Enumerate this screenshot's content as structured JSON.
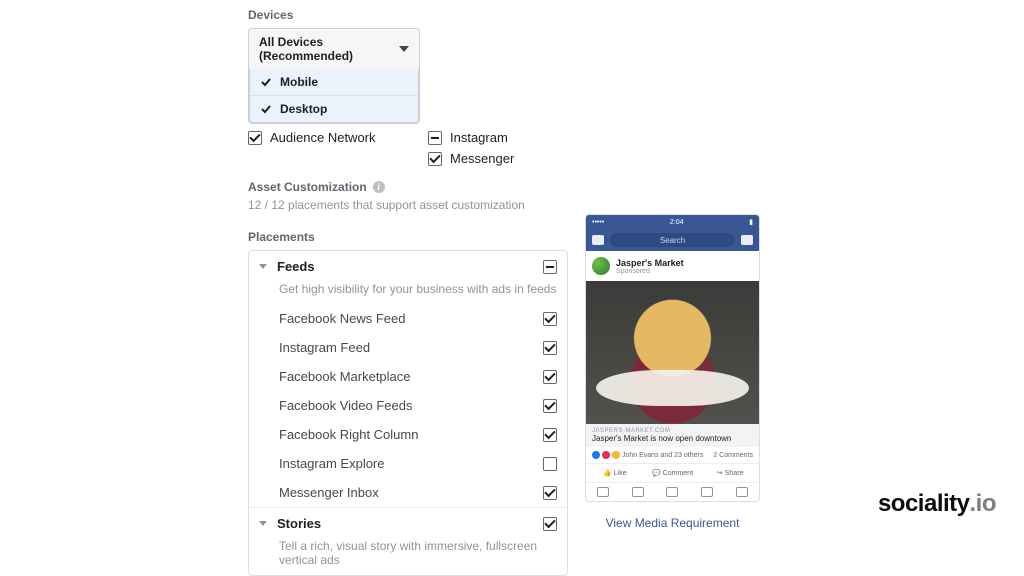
{
  "devices": {
    "label": "Devices",
    "selected": "All Devices (Recommended)",
    "options": [
      "Mobile",
      "Desktop"
    ]
  },
  "platforms": {
    "instagram": "Instagram",
    "audience_network": "Audience Network",
    "messenger": "Messenger"
  },
  "asset": {
    "title": "Asset Customization",
    "subtitle": "12 / 12 placements that support asset customization"
  },
  "placements": {
    "label": "Placements",
    "groups": [
      {
        "title": "Feeds",
        "desc": "Get high visibility for your business with ads in feeds",
        "state": "indeterminate",
        "items": [
          {
            "label": "Facebook News Feed",
            "checked": true
          },
          {
            "label": "Instagram Feed",
            "checked": true
          },
          {
            "label": "Facebook Marketplace",
            "checked": true
          },
          {
            "label": "Facebook Video Feeds",
            "checked": true
          },
          {
            "label": "Facebook Right Column",
            "checked": true
          },
          {
            "label": "Instagram Explore",
            "checked": false
          },
          {
            "label": "Messenger Inbox",
            "checked": true
          }
        ]
      },
      {
        "title": "Stories",
        "desc": "Tell a rich, visual story with immersive, fullscreen vertical ads",
        "state": "checked"
      }
    ]
  },
  "preview": {
    "time": "2:04",
    "search_placeholder": "Search",
    "page_name": "Jasper's Market",
    "sponsored": "Sponsored",
    "link_host": "JASPERS-MARKET.COM",
    "link_title": "Jasper's Market is now open downtown",
    "social_text": "John Evans and 23 others",
    "comments": "2 Comments",
    "like": "Like",
    "comment": "Comment",
    "share": "Share",
    "view_media": "View Media Requirement"
  },
  "brand": {
    "name": "sociality",
    "suffix": ".io"
  }
}
